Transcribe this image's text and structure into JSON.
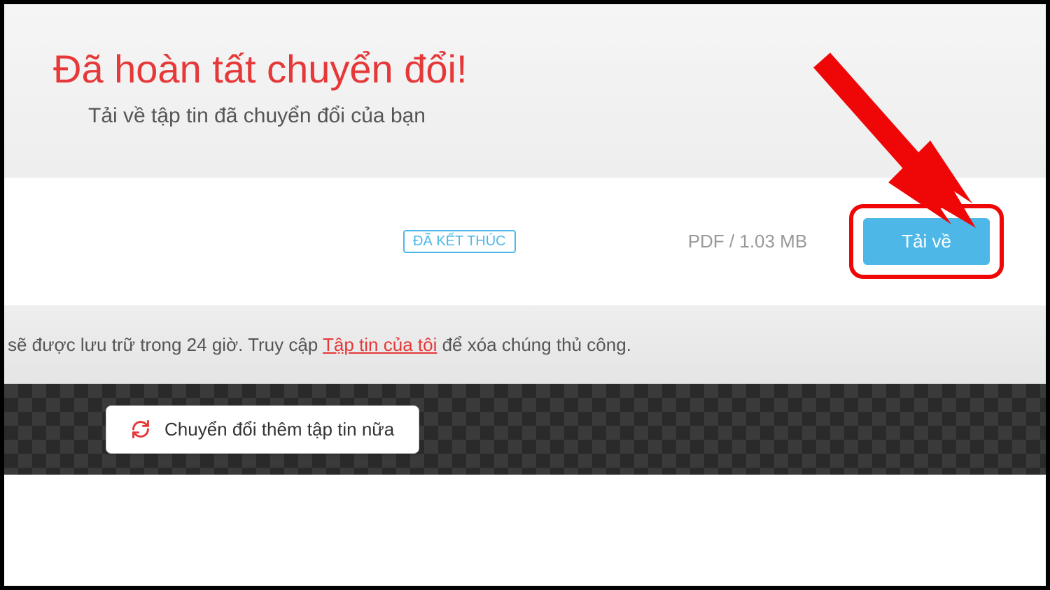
{
  "header": {
    "title": "Đã hoàn tất chuyển đổi!",
    "subtitle": "Tải về tập tin đã chuyển đổi của bạn"
  },
  "file": {
    "status_label": "ĐÃ KẾT THÚC",
    "file_info": "PDF / 1.03 MB",
    "download_label": "Tải về"
  },
  "storage": {
    "prefix": "sẽ được lưu trữ trong 24 giờ. Truy cập ",
    "link_text": "Tập tin của tôi",
    "suffix": " để xóa chúng thủ công."
  },
  "footer": {
    "convert_more_label": "Chuyển đổi thêm tập tin nữa"
  },
  "colors": {
    "accent_red": "#e63838",
    "accent_blue": "#4db8e8",
    "highlight_red": "#ef0707"
  }
}
